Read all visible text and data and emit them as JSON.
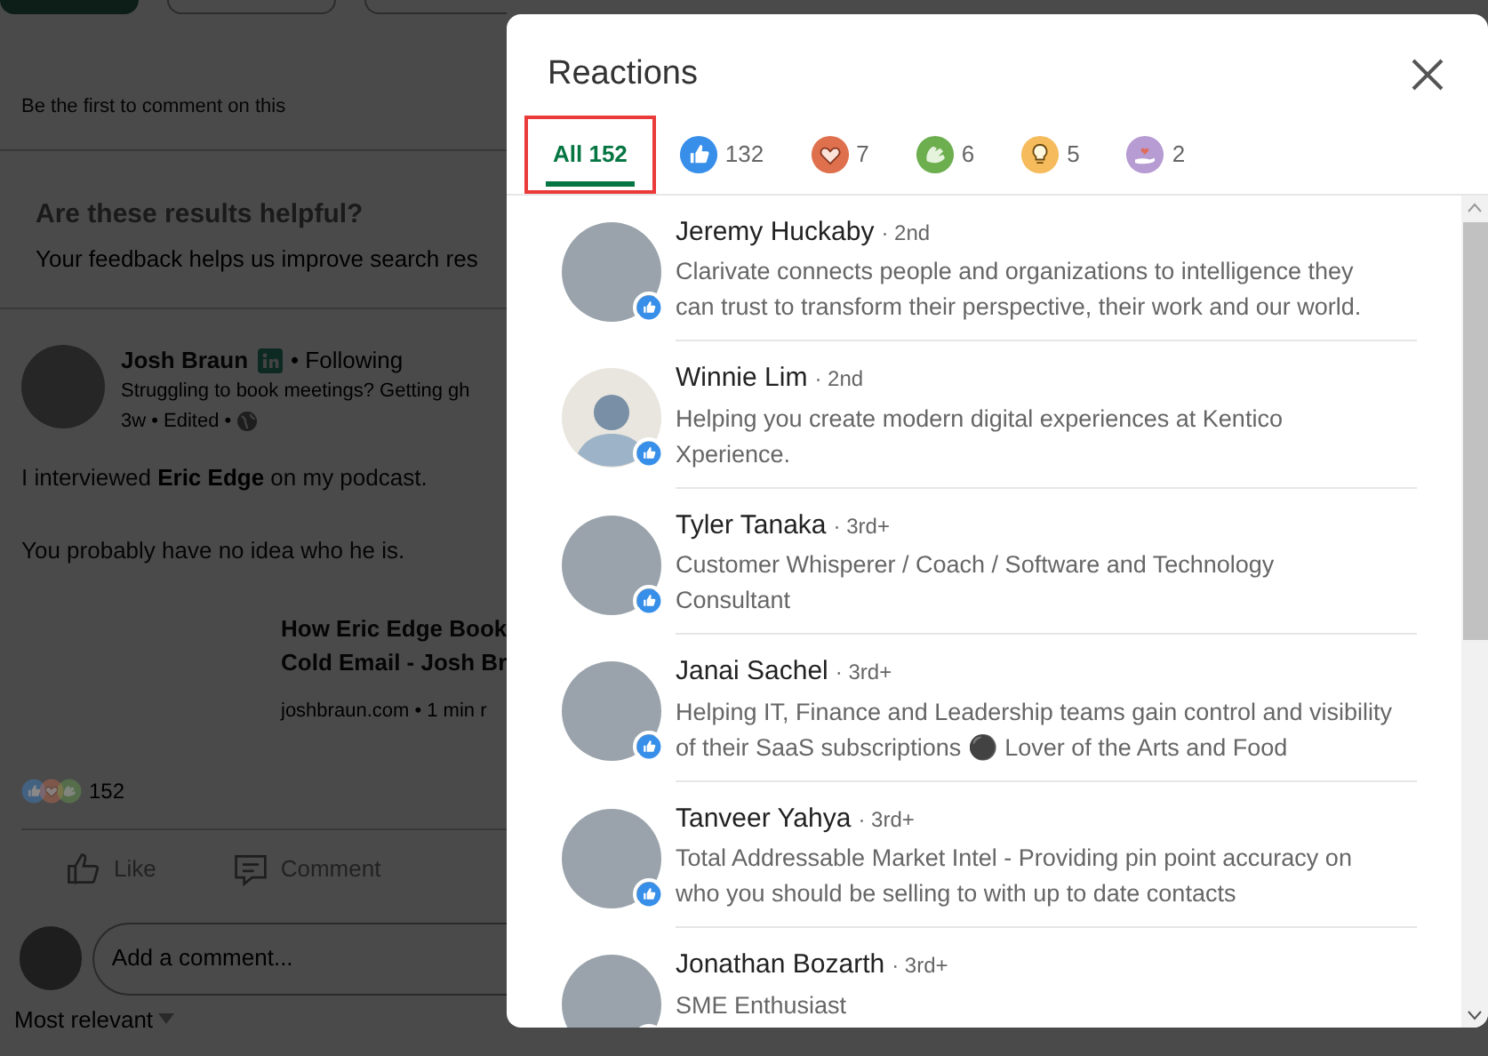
{
  "page": {
    "top_note": "Be the first to comment on this",
    "feedback": {
      "title": "Are these results helpful?",
      "text": "Your feedback helps us improve search res"
    },
    "post": {
      "author": "Josh Braun",
      "following": "• Following",
      "headline": "Struggling to book meetings? Getting gh",
      "meta": "3w • Edited •",
      "intro": {
        "before": "I interviewed ",
        "link": "Eric Edge",
        "after": " on my podcast."
      },
      "body": "You probably have no idea who he is.",
      "link_card": {
        "title_lines": [
          "How Eric Edge Book",
          "Cold Email - Josh Br"
        ],
        "source": "joshbraun.com • 1 min r"
      },
      "reaction_count": "152",
      "actions": [
        {
          "kind": "like",
          "label": "Like"
        },
        {
          "kind": "comment",
          "label": "Comment"
        }
      ],
      "comment_placeholder": "Add a comment...",
      "sort": "Most relevant"
    }
  },
  "modal": {
    "title": "Reactions",
    "tabs": [
      {
        "kind": "all",
        "label": "All 152",
        "selected": true,
        "highlighted": true
      },
      {
        "kind": "like",
        "label": "132",
        "selected": false,
        "highlighted": false
      },
      {
        "kind": "love",
        "label": "7",
        "selected": false,
        "highlighted": false
      },
      {
        "kind": "celebrate",
        "label": "6",
        "selected": false,
        "highlighted": false
      },
      {
        "kind": "insightful",
        "label": "5",
        "selected": false,
        "highlighted": false
      },
      {
        "kind": "support",
        "label": "2",
        "selected": false,
        "highlighted": false
      }
    ],
    "people": [
      {
        "name": "Jeremy Huckaby",
        "degree": "· 2nd",
        "headline": "Clarivate connects people and organizations to intelligence they can trust to transform their perspective, their work and our world.",
        "kind": "photo"
      },
      {
        "name": "Winnie Lim",
        "degree": "· 2nd",
        "headline": "Helping you create modern digital experiences at Kentico Xperience.",
        "kind": "silhouette"
      },
      {
        "name": "Tyler Tanaka",
        "degree": "· 3rd+",
        "headline": "Customer Whisperer / Coach / Software and Technology Consultant",
        "kind": "photo"
      },
      {
        "name": "Janai Sachel",
        "degree": "· 3rd+",
        "headline": "Helping IT, Finance and Leadership teams gain control and visibility of their SaaS subscriptions ⚫ Lover of the Arts and Food",
        "kind": "photo"
      },
      {
        "name": "Tanveer Yahya",
        "degree": "· 3rd+",
        "headline": "Total Addressable Market Intel - Providing pin point accuracy on who you should be selling to with up to date contacts",
        "kind": "photo"
      },
      {
        "name": "Jonathan Bozarth",
        "degree": "· 3rd+",
        "headline": "SME Enthusiast",
        "kind": "photo"
      }
    ]
  }
}
